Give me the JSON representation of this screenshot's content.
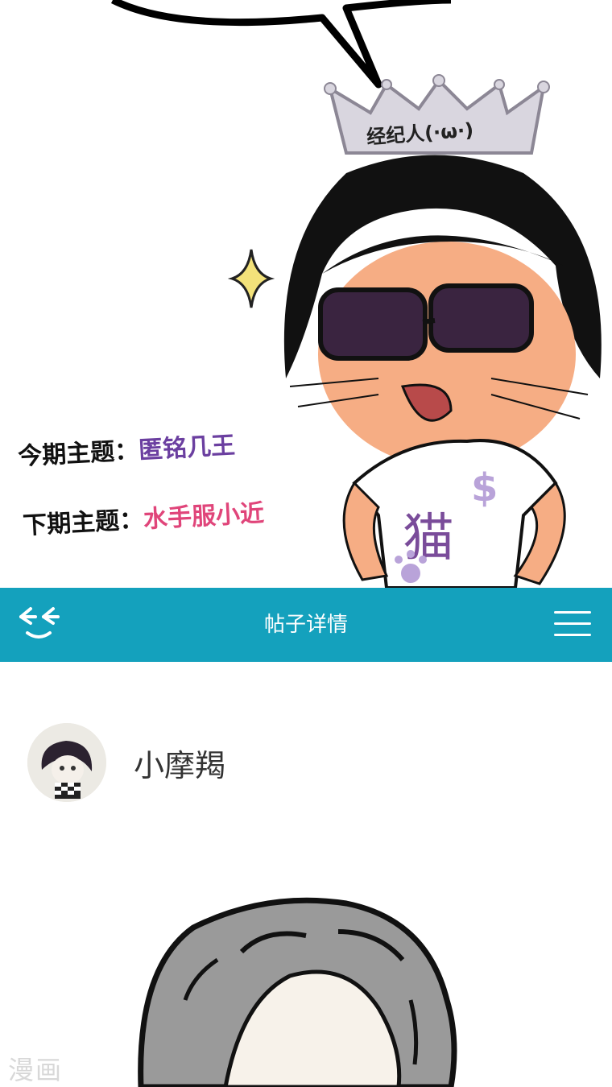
{
  "comic": {
    "crown_text": "经纪人(·ω·)",
    "current_theme_label": "今期主题：",
    "current_theme_value": "匿铭几王",
    "next_theme_label": "下期主题：",
    "next_theme_value": "水手服小近"
  },
  "navbar": {
    "back_icon": "back-face-icon",
    "title": "帖子详情",
    "menu_icon": "menu-icon",
    "background": "#14a1bd"
  },
  "post": {
    "author_name": "小摩羯",
    "watermark": "漫画"
  }
}
